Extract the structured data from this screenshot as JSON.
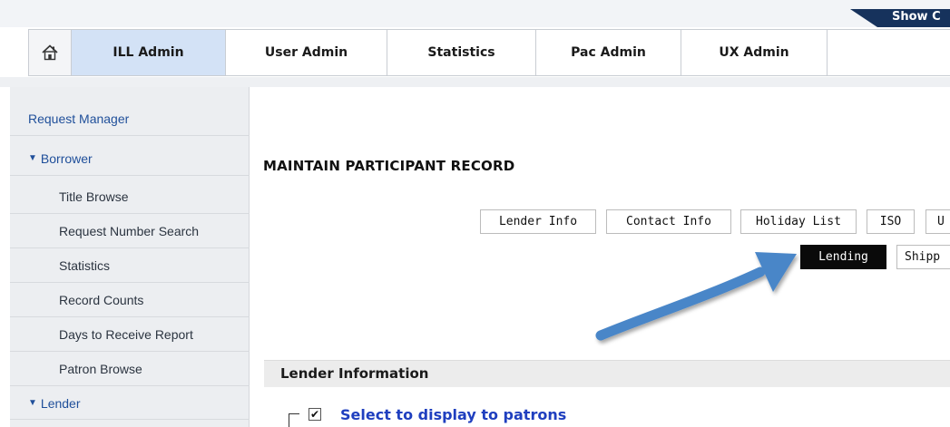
{
  "top_tab": {
    "label": "Show C",
    "color": "#16325c"
  },
  "nav": {
    "home_icon": "home-icon",
    "items": [
      {
        "label": "ILL Admin",
        "active": true
      },
      {
        "label": "User Admin"
      },
      {
        "label": "Statistics"
      },
      {
        "label": "Pac Admin"
      },
      {
        "label": "UX Admin"
      }
    ]
  },
  "sidebar": {
    "request_manager": "Request Manager",
    "borrower": "Borrower",
    "borrower_items": [
      "Title Browse",
      "Request Number Search",
      "Statistics",
      "Record Counts",
      "Days to Receive Report",
      "Patron Browse"
    ],
    "lender": "Lender"
  },
  "main": {
    "title": "MAINTAIN PARTICIPANT RECORD",
    "tabs_row1": [
      "Lender Info",
      "Contact Info",
      "Holiday List",
      "ISO",
      "U"
    ],
    "tabs_row2": [
      "Lending",
      "Shipp"
    ],
    "active_tab": "Lending",
    "section_title": "Lender Information",
    "checkbox_label": "Select to display to patrons",
    "checkbox_checked": true
  },
  "colors": {
    "accent": "#1f4f9a",
    "nav_active": "#d3e2f6",
    "arrow": "#4a86c8",
    "link_blue": "#1f3fbf"
  }
}
